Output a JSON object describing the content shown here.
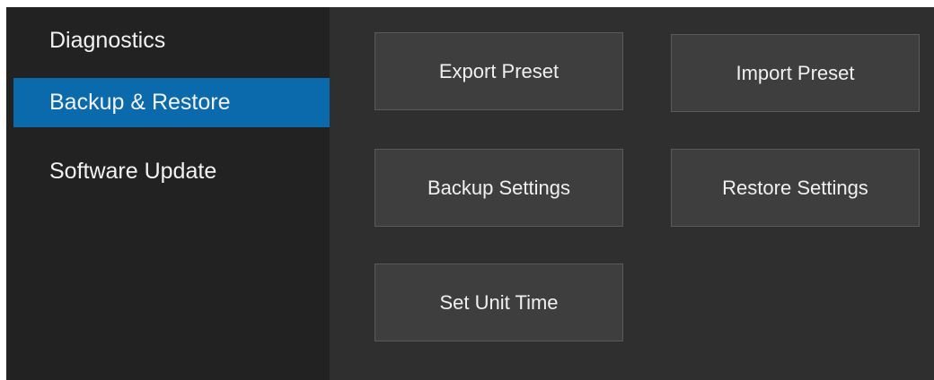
{
  "sidebar": {
    "items": [
      {
        "label": "Diagnostics",
        "selected": false
      },
      {
        "label": "Backup & Restore",
        "selected": true
      },
      {
        "label": "Software Update",
        "selected": false
      }
    ]
  },
  "actions": {
    "export_preset": "Export Preset",
    "import_preset": "Import Preset",
    "backup_settings": "Backup Settings",
    "restore_settings": "Restore Settings",
    "set_unit_time": "Set Unit Time"
  },
  "colors": {
    "sidebar_bg": "#222222",
    "content_bg": "#2f2f2f",
    "selected_bg": "#0b6aab",
    "button_bg": "#3e3e3e",
    "button_border": "#5a5a5a",
    "text": "#f0f0f0"
  }
}
